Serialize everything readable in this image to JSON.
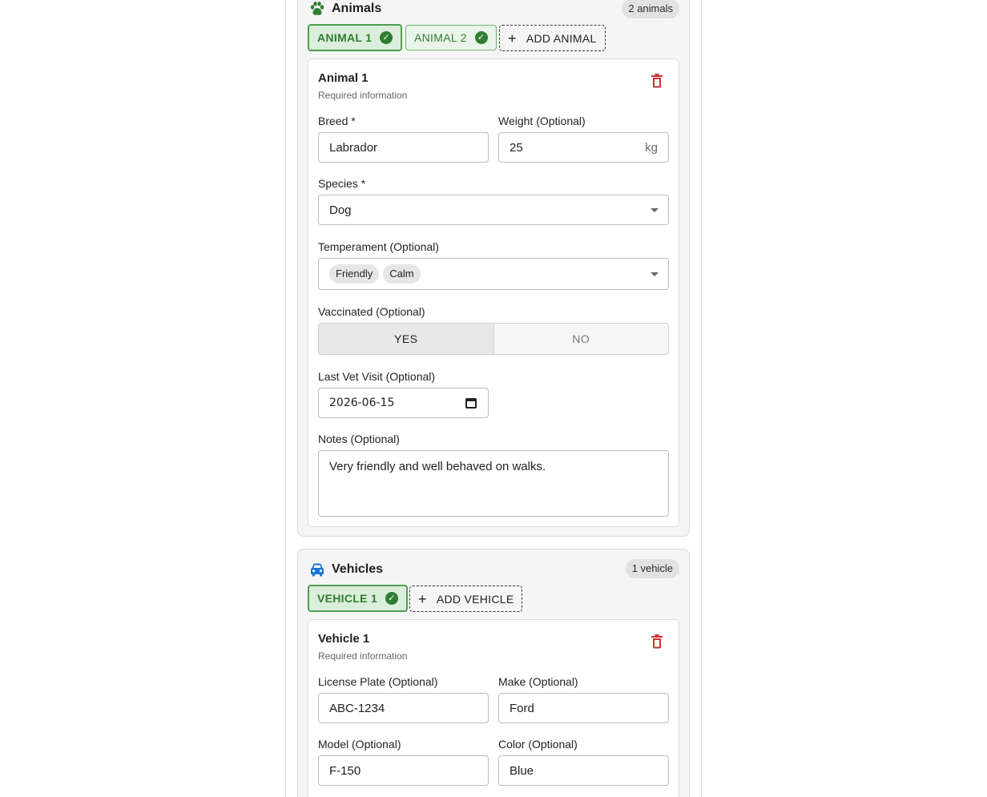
{
  "animals": {
    "title": "Animals",
    "count_badge": "2 animals",
    "tabs": [
      {
        "label": "ANIMAL 1",
        "complete": true,
        "active": true
      },
      {
        "label": "ANIMAL 2",
        "complete": true,
        "active": false
      }
    ],
    "add_label": "ADD ANIMAL",
    "card": {
      "title": "Animal 1",
      "subtitle": "Required information",
      "breed": {
        "label": "Breed *",
        "value": "Labrador"
      },
      "weight": {
        "label": "Weight (Optional)",
        "value": "25",
        "unit": "kg"
      },
      "species": {
        "label": "Species *",
        "value": "Dog"
      },
      "temperament": {
        "label": "Temperament (Optional)",
        "chips": [
          "Friendly",
          "Calm"
        ]
      },
      "vaccinated": {
        "label": "Vaccinated (Optional)",
        "options": [
          "YES",
          "NO"
        ],
        "selected": "YES"
      },
      "last_vet_visit": {
        "label": "Last Vet Visit (Optional)",
        "value": "2026-06-15"
      },
      "notes": {
        "label": "Notes (Optional)",
        "value": "Very friendly and well behaved on walks."
      }
    }
  },
  "vehicles": {
    "title": "Vehicles",
    "count_badge": "1 vehicle",
    "tabs": [
      {
        "label": "VEHICLE 1",
        "complete": true,
        "active": true
      }
    ],
    "add_label": "ADD VEHICLE",
    "card": {
      "title": "Vehicle 1",
      "subtitle": "Required information",
      "license_plate": {
        "label": "License Plate (Optional)",
        "value": "ABC-1234"
      },
      "make": {
        "label": "Make (Optional)",
        "value": "Ford"
      },
      "model": {
        "label": "Model (Optional)",
        "value": "F-150"
      },
      "color": {
        "label": "Color (Optional)",
        "value": "Blue"
      }
    }
  },
  "colors": {
    "success": "#2e7d32",
    "danger": "#d32f2f",
    "vehicle_icon": "#1976d2"
  },
  "icons": {
    "animals": "paw-icon",
    "vehicles": "car-icon",
    "complete": "check-circle-icon",
    "delete": "trash-icon"
  }
}
